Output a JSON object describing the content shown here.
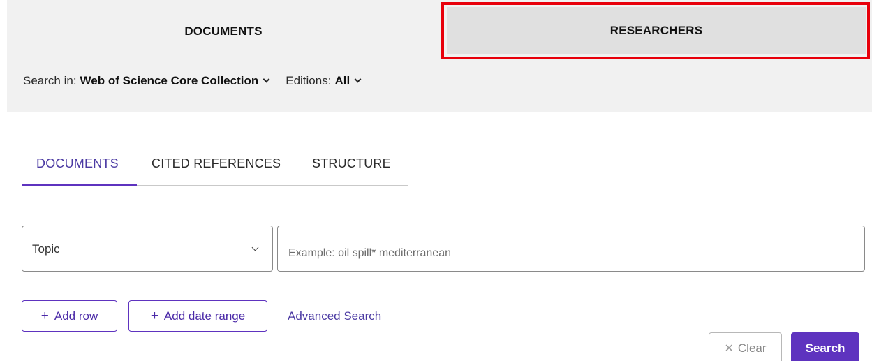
{
  "top_tabs": {
    "documents": "DOCUMENTS",
    "researchers": "RESEARCHERS"
  },
  "search_scope": {
    "search_in_label": "Search in:",
    "collection": "Web of Science Core Collection",
    "editions_label": "Editions:",
    "editions_value": "All"
  },
  "sub_tabs": [
    {
      "label": "DOCUMENTS",
      "active": true
    },
    {
      "label": "CITED REFERENCES",
      "active": false
    },
    {
      "label": "STRUCTURE",
      "active": false
    }
  ],
  "query_row": {
    "field": "Topic",
    "placeholder": "Example: oil spill* mediterranean"
  },
  "actions": {
    "add_row": "Add row",
    "add_date_range": "Add date range",
    "advanced_search": "Advanced Search",
    "clear": "Clear",
    "search": "Search"
  },
  "colors": {
    "accent": "#5e33bf",
    "highlight": "#e8000b"
  }
}
